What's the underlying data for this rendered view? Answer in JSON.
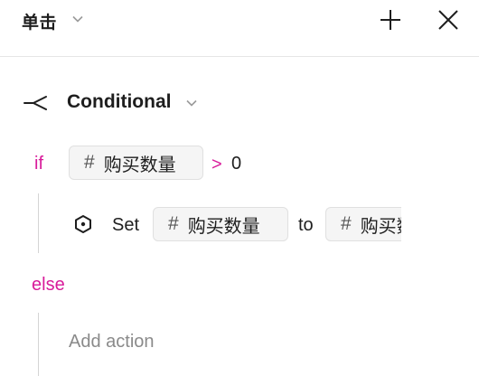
{
  "header": {
    "title": "单击",
    "add_icon": "plus-icon",
    "close_icon": "close-icon"
  },
  "conditional": {
    "label": "Conditional",
    "icon": "branch-icon",
    "if_keyword": "if",
    "condition": {
      "variable_hash": "#",
      "variable": "购买数量",
      "operator": ">",
      "value": "0"
    },
    "then_action": {
      "icon": "hexagon-icon",
      "verb": "Set",
      "target_hash": "#",
      "target": "购买数量",
      "to": "to",
      "source_hash": "#",
      "source": "购买数量"
    },
    "else_keyword": "else",
    "else_action_placeholder": "Add action"
  },
  "colors": {
    "keyword": "#d81b9a",
    "chip_bg": "#f5f5f5",
    "muted": "#8a8a8a"
  }
}
